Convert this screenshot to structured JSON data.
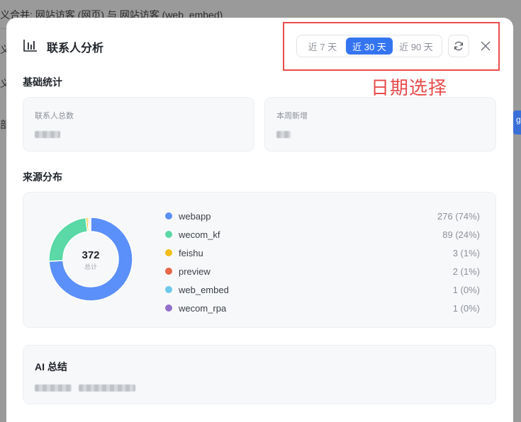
{
  "background": {
    "top_text": "义合并: 网站访客 (网页) 与 网站访客 (web_embed)",
    "side_fragments": [
      "义",
      "义",
      "部"
    ],
    "right_button": "g"
  },
  "modal": {
    "title": "联系人分析",
    "title_icon": "bar-chart-icon",
    "ranges": [
      {
        "label": "近 7 天",
        "active": false
      },
      {
        "label": "近 30 天",
        "active": true
      },
      {
        "label": "近 90 天",
        "active": false
      }
    ],
    "refresh_icon": "refresh-icon",
    "close_icon": "close-icon"
  },
  "annotation": {
    "text": "日期选择",
    "color": "#e84c4c"
  },
  "basic_stats": {
    "title": "基础统计",
    "cards": [
      {
        "label": "联系人总数"
      },
      {
        "label": "本周新增"
      }
    ]
  },
  "source": {
    "title": "来源分布",
    "total": "372",
    "total_label": "总计"
  },
  "chart_data": {
    "type": "pie",
    "title": "",
    "total": 372,
    "series": [
      {
        "name": "webapp",
        "value": 276,
        "display": "276 (74%)",
        "color": "#5b8ff9"
      },
      {
        "name": "wecom_kf",
        "value": 89,
        "display": "89 (24%)",
        "color": "#5ad8a6"
      },
      {
        "name": "feishu",
        "value": 3,
        "display": "3 (1%)",
        "color": "#f6bd16"
      },
      {
        "name": "preview",
        "value": 2,
        "display": "2 (1%)",
        "color": "#e8684a"
      },
      {
        "name": "web_embed",
        "value": 1,
        "display": "1 (0%)",
        "color": "#6dc8ec"
      },
      {
        "name": "wecom_rpa",
        "value": 1,
        "display": "1 (0%)",
        "color": "#9270ca"
      }
    ]
  },
  "ai": {
    "title": "AI 总结"
  },
  "colors": {
    "accent": "#3574f0"
  }
}
